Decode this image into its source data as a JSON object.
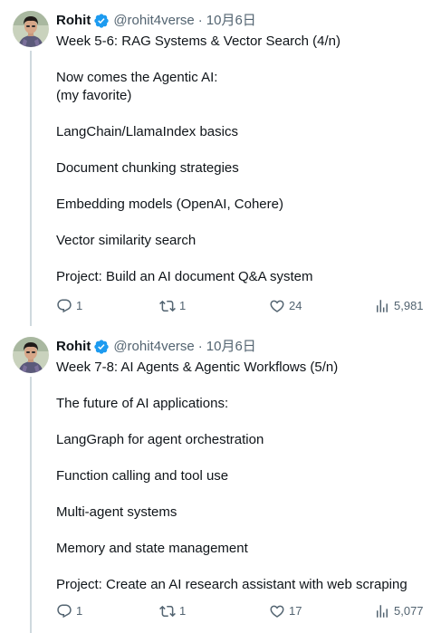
{
  "tweets": [
    {
      "author": {
        "display_name": "Rohit",
        "handle": "@rohit4verse",
        "verified": true,
        "separator": "·",
        "date": "10月6日",
        "avatar_icon": "avatar-photo"
      },
      "lines": [
        "Week 5-6: RAG Systems & Vector Search (4/n)",
        "",
        "Now comes the Agentic AI:",
        "(my favorite)",
        "",
        "LangChain/LlamaIndex basics",
        "",
        "Document chunking strategies",
        "",
        "Embedding models (OpenAI, Cohere)",
        "",
        "Vector similarity search",
        "",
        "Project: Build an AI document Q&A system"
      ],
      "stats": {
        "replies": "1",
        "retweets": "1",
        "likes": "24",
        "views": "5,981"
      }
    },
    {
      "author": {
        "display_name": "Rohit",
        "handle": "@rohit4verse",
        "verified": true,
        "separator": "·",
        "date": "10月6日",
        "avatar_icon": "avatar-photo"
      },
      "lines": [
        "Week 7-8: AI Agents & Agentic Workflows (5/n)",
        "",
        "The future of AI applications:",
        "",
        "LangGraph for agent orchestration",
        "",
        "Function calling and tool use",
        "",
        "Multi-agent systems",
        "",
        "Memory and state management",
        "",
        "Project: Create an AI research assistant with web scraping"
      ],
      "stats": {
        "replies": "1",
        "retweets": "1",
        "likes": "17",
        "views": "5,077"
      }
    }
  ],
  "colors": {
    "text_primary": "#0f1419",
    "text_secondary": "#536471",
    "verified_blue": "#1d9bf0",
    "thread_line": "#cfd9de"
  },
  "icons": {
    "reply": "reply-icon",
    "retweet": "retweet-icon",
    "like": "heart-icon",
    "views": "views-icon",
    "verified": "verified-badge-icon"
  }
}
